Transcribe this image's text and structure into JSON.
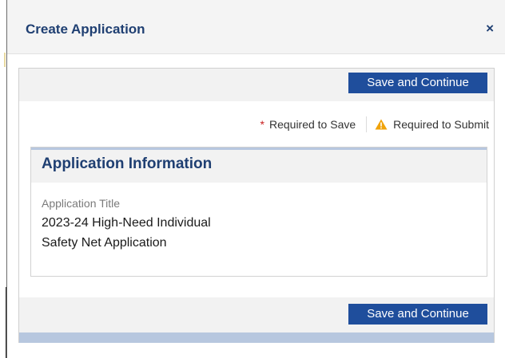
{
  "modal": {
    "title": "Create Application",
    "close_glyph": "×"
  },
  "toolbar": {
    "save_continue_label": "Save and Continue"
  },
  "legend": {
    "required_save_marker": "*",
    "required_save_text": "Required to Save",
    "required_submit_text": "Required to Submit",
    "warning_icon": "warning-triangle-icon",
    "warning_color": "#f0a30a",
    "required_color": "#c81e1e"
  },
  "section": {
    "title": "Application Information",
    "field_label": "Application Title",
    "field_value_line1": "2023-24 High-Need Individual",
    "field_value_line2": "Safety Net Application"
  },
  "colors": {
    "primary": "#1f4e9c",
    "title": "#1f3f72",
    "panel": "#f2f2f2",
    "accent_bar": "#b7c7df"
  }
}
